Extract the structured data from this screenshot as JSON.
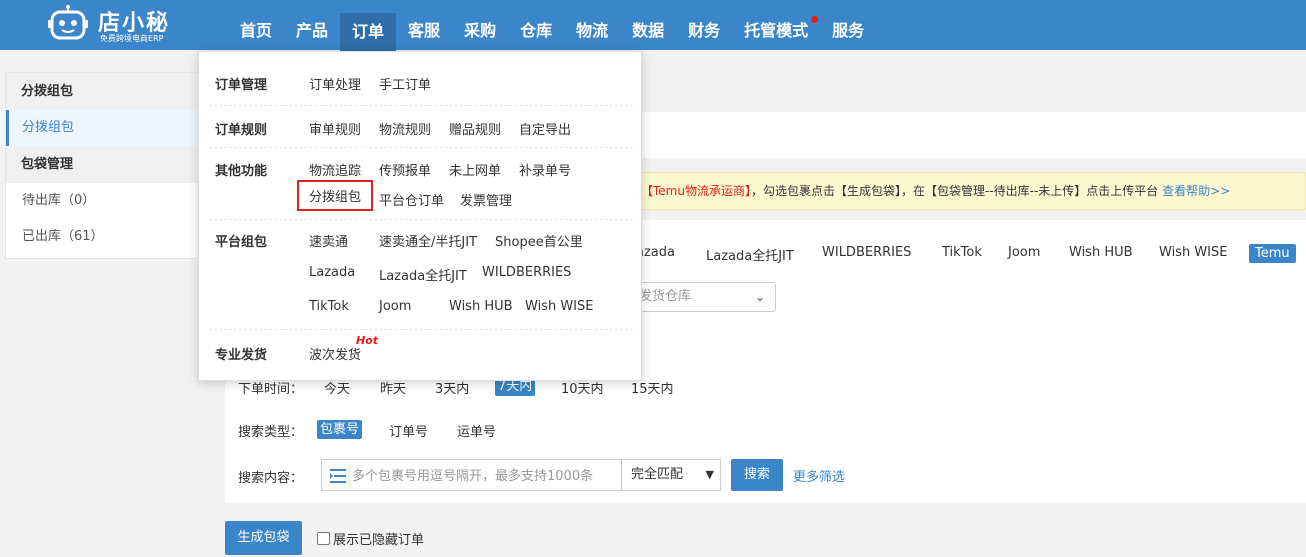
{
  "logo": {
    "name": "店小秘",
    "tagline": "免费跨境电商ERP"
  },
  "nav": {
    "items": [
      "首页",
      "产品",
      "订单",
      "客服",
      "采购",
      "仓库",
      "物流",
      "数据",
      "财务",
      "托管模式",
      "服务"
    ],
    "active": "订单"
  },
  "sidebar": {
    "group1_title": "分拨组包",
    "group1_item": "分拨组包",
    "group2_title": "包袋管理",
    "pending": "待出库（0）",
    "shipped": "已出库（61）"
  },
  "notice": {
    "highlight": "【Temu物流承运商】",
    "text": "，勾选包裹点击【生成包袋】，在【包袋管理--待出库--未上传】点击上传平台",
    "help": "查看帮助>>"
  },
  "platforms": {
    "items": [
      "azada",
      "Lazada全托JIT",
      "WILDBERRIES",
      "TikTok",
      "Joom",
      "Wish HUB",
      "Wish WISE"
    ],
    "selected": "Temu"
  },
  "warehouse_placeholder": "发货仓库",
  "filters": {
    "order_time_label": "下单时间：",
    "order_time_options": [
      "今天",
      "昨天",
      "3天内",
      "7天内",
      "10天内",
      "15天内"
    ],
    "order_time_selected": "7天内",
    "search_type_label": "搜索类型：",
    "search_type_options": [
      "包裹号",
      "订单号",
      "运单号"
    ],
    "search_type_selected": "包裹号",
    "search_content_label": "搜索内容：",
    "search_placeholder": "多个包裹号用逗号隔开，最多支持1000条",
    "match_mode": "完全匹配",
    "search_button": "搜索",
    "more_filters": "更多筛选"
  },
  "actions": {
    "generate_bag": "生成包袋",
    "show_hidden": "展示已隐藏订单"
  },
  "dropdown": {
    "order_mgmt": {
      "title": "订单管理",
      "links": [
        "订单处理",
        "手工订单"
      ]
    },
    "order_rules": {
      "title": "订单规则",
      "links": [
        "审单规则",
        "物流规则",
        "赠品规则",
        "自定导出"
      ]
    },
    "other": {
      "title": "其他功能",
      "links": [
        "物流追踪",
        "传预报单",
        "未上网单",
        "补录单号",
        "分拨组包",
        "平台仓订单",
        "发票管理"
      ]
    },
    "platform_bag": {
      "title": "平台组包",
      "links": [
        "速卖通",
        "速卖通全/半托JIT",
        "Shopee首公里",
        "Lazada",
        "Lazada全托JIT",
        "WILDBERRIES",
        "TikTok",
        "Joom",
        "Wish HUB",
        "Wish WISE"
      ]
    },
    "pro_ship": {
      "title": "专业发货",
      "links": [
        "波次发货"
      ],
      "hot": "Hot"
    }
  }
}
